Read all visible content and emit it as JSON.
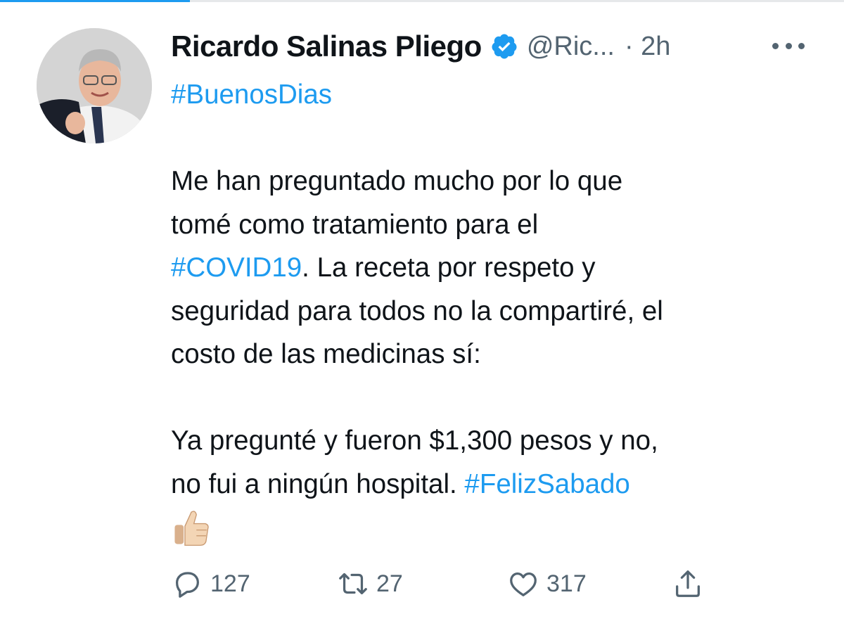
{
  "tweet": {
    "author_name": "Ricardo Salinas Pliego",
    "handle": "@Ric...",
    "time": "· 2h",
    "hashtag_top": "#BuenosDias",
    "line1": "Me han preguntado mucho por lo que",
    "line2": "tomé como tratamiento para el",
    "hashtag_covid": "#COVID19",
    "line3_rest": ". La receta por respeto y",
    "line4": "seguridad para todos no la compartiré, el",
    "line5": "costo de las medicinas sí:",
    "line6": "Ya pregunté y fueron $1,300 pesos y no,",
    "line7": "no fui a ningún hospital.",
    "hashtag_end": "#FelizSabado",
    "emoji": "thumbs-up"
  },
  "actions": {
    "replies": "127",
    "retweets": "27",
    "likes": "317"
  },
  "colors": {
    "link": "#1d9bf0",
    "text": "#0f1419",
    "muted": "#536471"
  }
}
